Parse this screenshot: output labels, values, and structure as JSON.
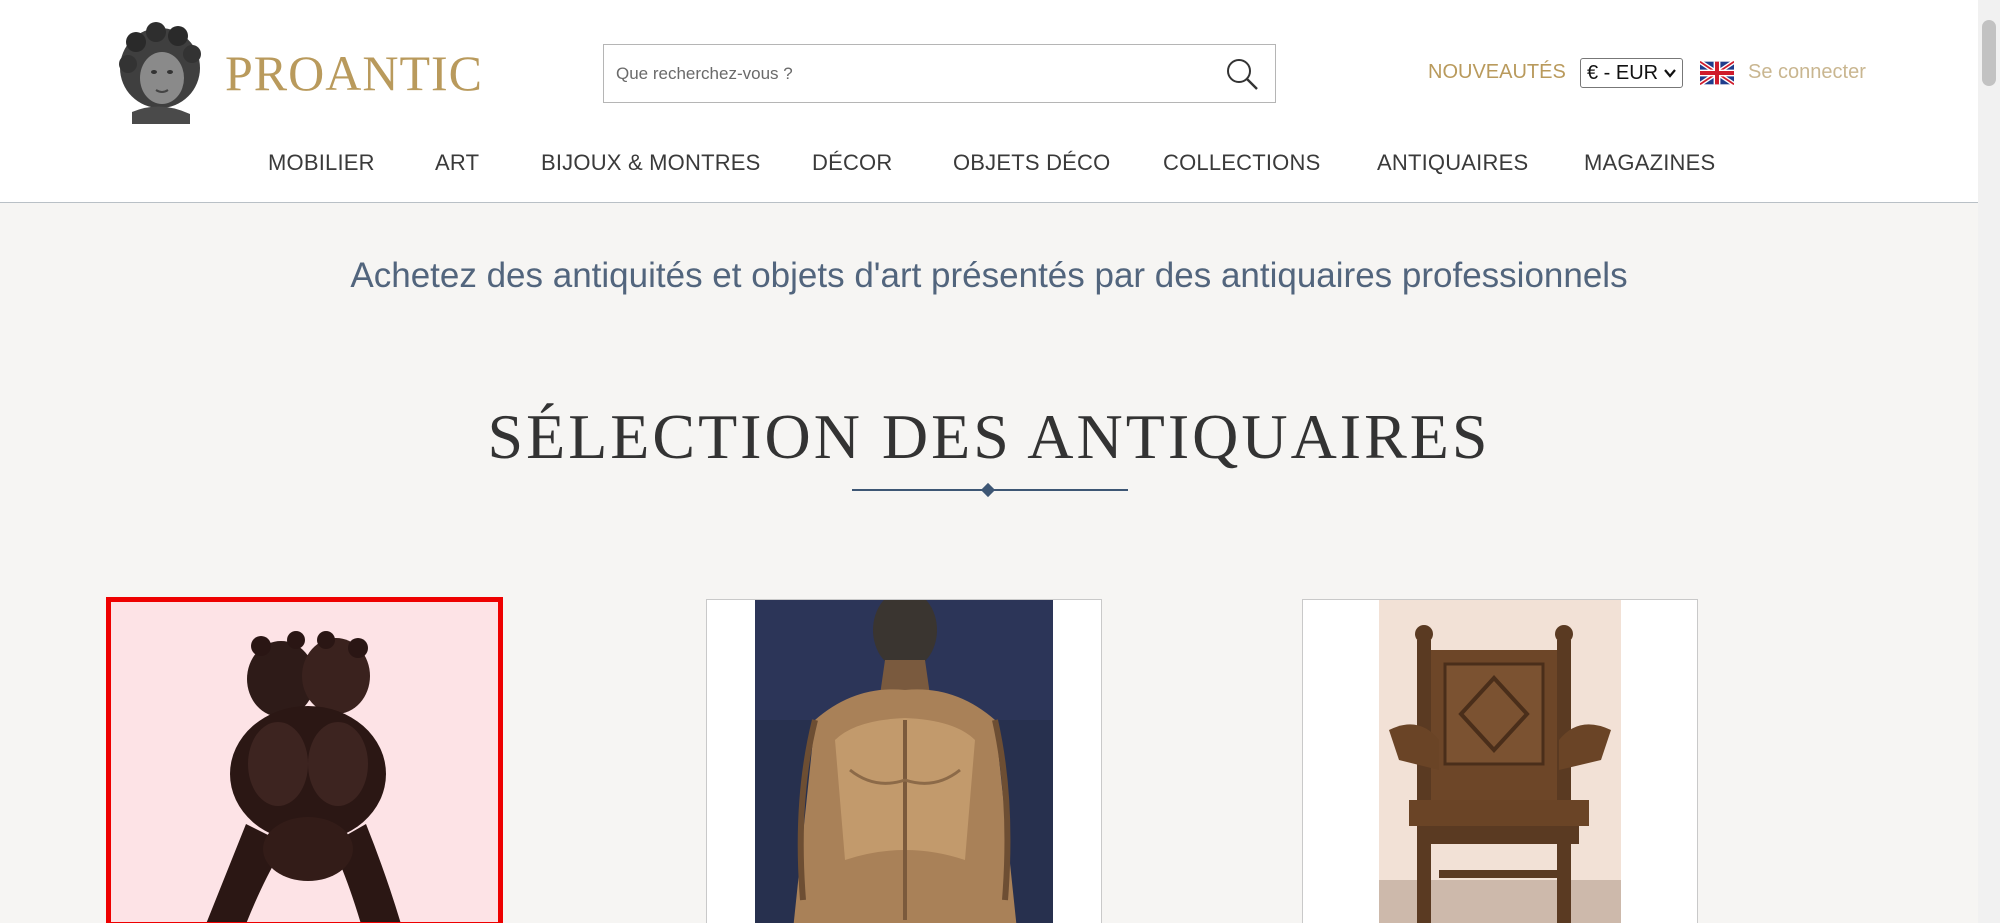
{
  "header": {
    "logo_text": "PROANTIC",
    "search_placeholder": "Que recherchez-vous ?",
    "nouveautes": "NOUVEAUTÉS",
    "currency": "€ - EUR",
    "login": "Se connecter"
  },
  "nav": [
    "MOBILIER",
    "ART",
    "BIJOUX & MONTRES",
    "DÉCOR",
    "OBJETS DÉCO",
    "COLLECTIONS",
    "ANTIQUAIRES",
    "MAGAZINES"
  ],
  "main": {
    "tagline": "Achetez des antiquités et objets d'art présentés par des antiquaires professionnels",
    "section_title": "SÉLECTION DES ANTIQUAIRES"
  },
  "colors": {
    "gold": "#b99a5c",
    "navy": "#3d5674",
    "highlight_border": "#ee0000"
  },
  "icons": [
    "search-icon",
    "uk-flag-icon",
    "chevron-down-icon"
  ]
}
